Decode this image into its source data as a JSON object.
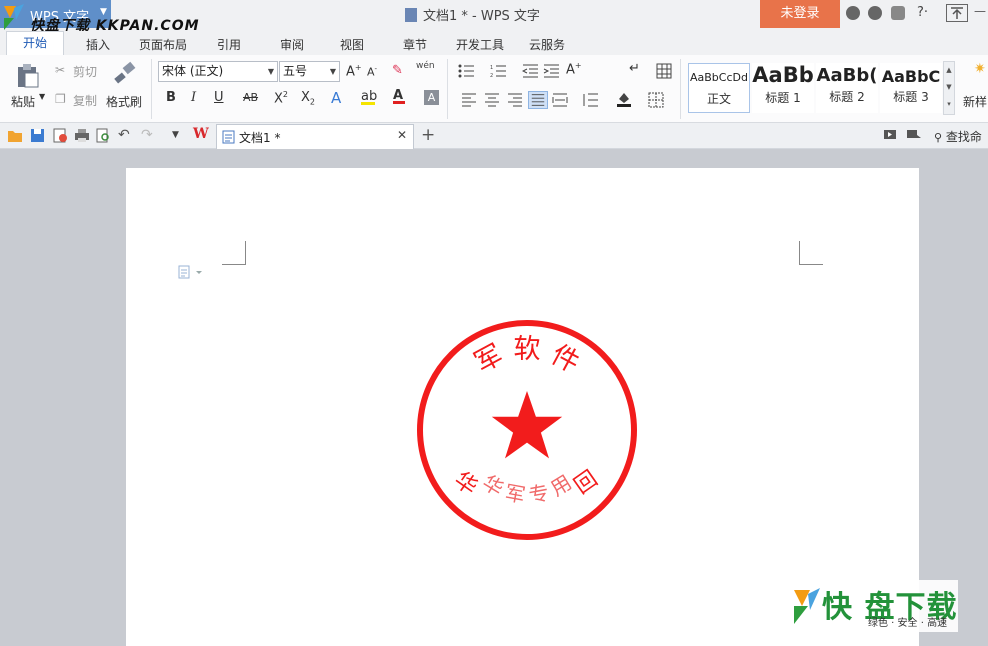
{
  "app": {
    "name": "WPS 文字",
    "window_title": "文档1 * - WPS 文字",
    "login": "未登录",
    "watermark_top": "快盘下载 KKPAN.COM"
  },
  "tabs": [
    "开始",
    "插入",
    "页面布局",
    "引用",
    "审阅",
    "视图",
    "章节",
    "开发工具",
    "云服务"
  ],
  "ribbon": {
    "clipboard": {
      "paste": "粘贴",
      "cut": "剪切",
      "copy": "复制",
      "format_painter": "格式刷"
    },
    "font": {
      "name": "宋体 (正文)",
      "size": "五号",
      "phonetic": "wén"
    },
    "styles": [
      {
        "preview": "AaBbCcDd",
        "name": "正文"
      },
      {
        "preview": "AaBb",
        "name": "标题 1"
      },
      {
        "preview": "AaBb(",
        "name": "标题 2"
      },
      {
        "preview": "AaBbC",
        "name": "标题 3"
      }
    ],
    "new_style": "新样"
  },
  "quickbar": {
    "doc_tab": "文档1 *",
    "search": "查找命"
  },
  "seal": {
    "top_text": "军 软 件",
    "bottom_text": "华 军 专 用",
    "side_left": "华",
    "side_right": "回",
    "color": "#f21c1c"
  },
  "watermark": {
    "brand": "快 盘下载",
    "slogan": "绿色 · 安全 · 高速"
  },
  "colors": {
    "accent": "#1f5bb5",
    "login": "#e8734a",
    "seal": "#f21c1c"
  }
}
